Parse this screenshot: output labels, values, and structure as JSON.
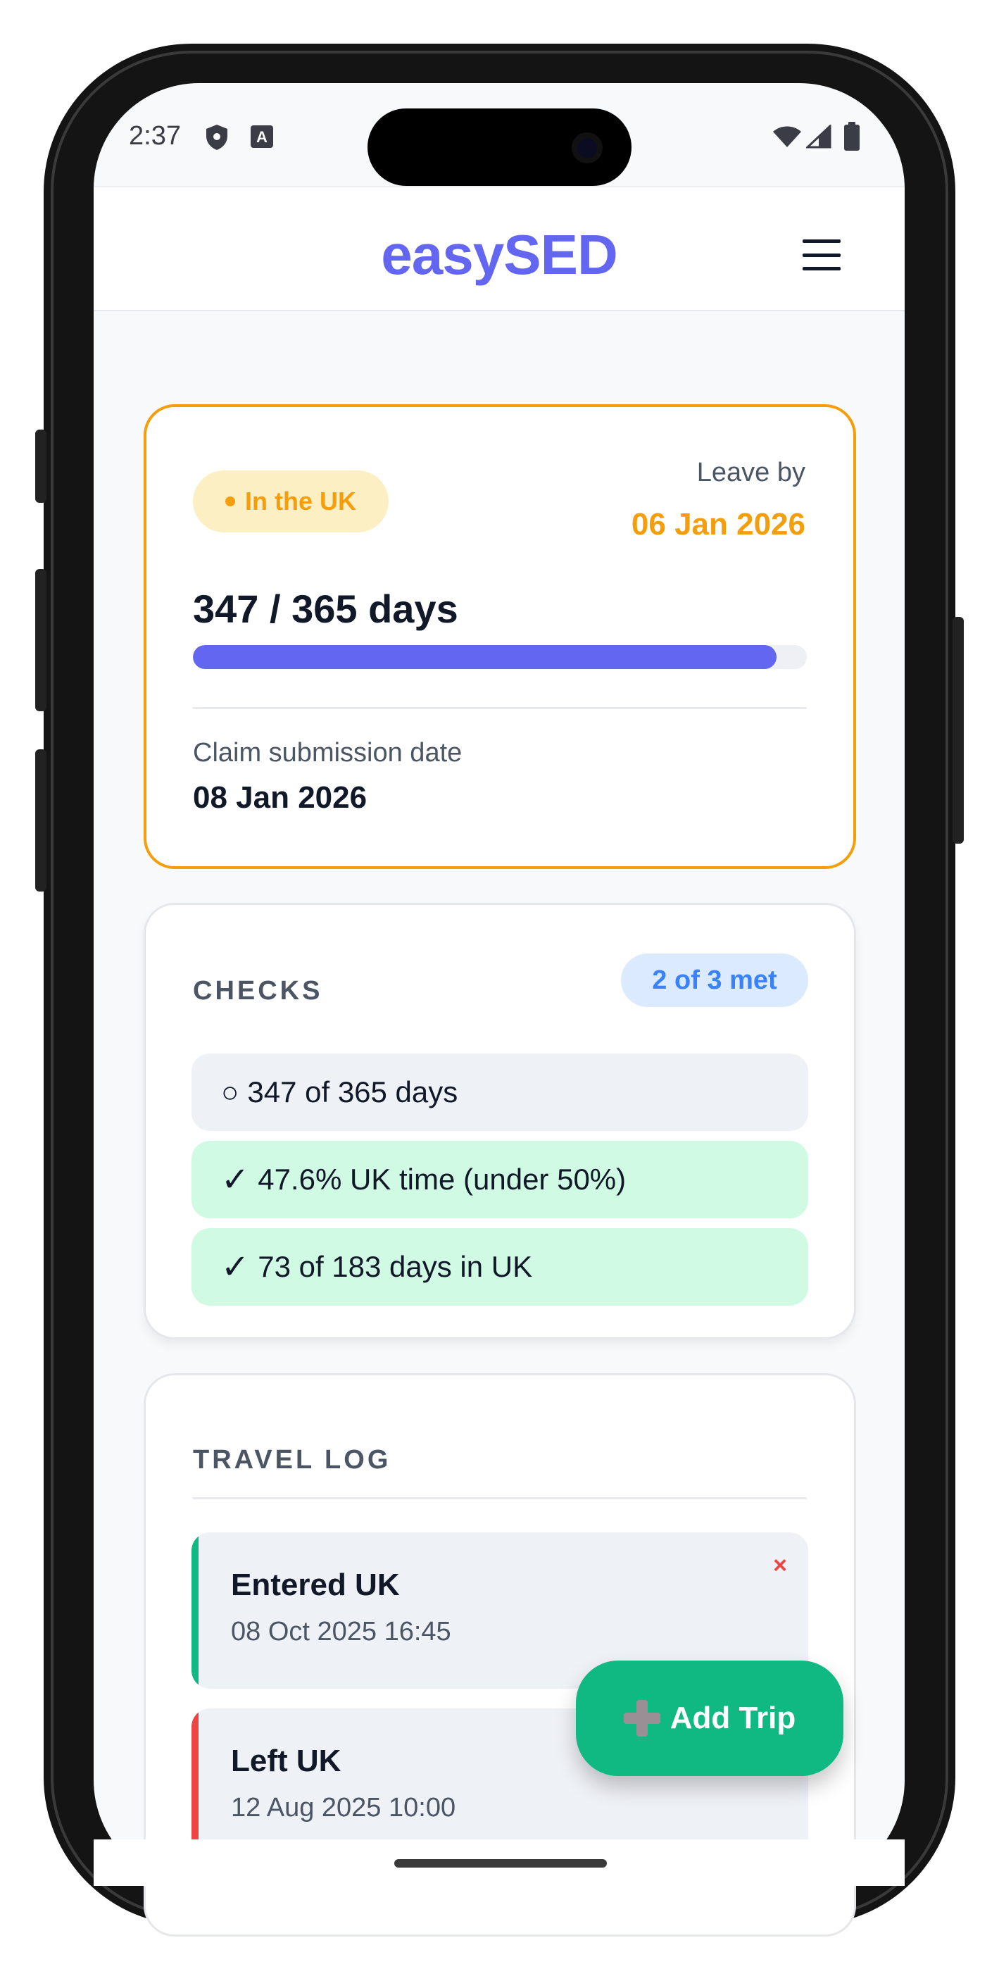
{
  "status_bar": {
    "time": "2:37",
    "left_icons": [
      "shield-icon",
      "a-letter-icon"
    ],
    "right_icons": [
      "wifi-icon",
      "signal-icon",
      "battery-icon"
    ]
  },
  "header": {
    "logo": "easySED",
    "menu_icon": "hamburger-menu-icon"
  },
  "status_card": {
    "badge": "In the UK",
    "leave_label": "Leave by",
    "leave_date": "06 Jan 2026",
    "days_text": "347 / 365 days",
    "progress": 0.9507,
    "claim_label": "Claim submission date",
    "claim_date": "08 Jan 2026"
  },
  "checks": {
    "title": "CHECKS",
    "met_badge": "2 of 3 met",
    "items": [
      {
        "symbol": "○",
        "text": "347 of 365 days",
        "met": false
      },
      {
        "symbol": "✓",
        "text": "47.6% UK time (under 50%)",
        "met": true
      },
      {
        "symbol": "✓",
        "text": "73 of 183 days in UK",
        "met": true
      }
    ]
  },
  "travel_log": {
    "title": "TRAVEL LOG",
    "entries": [
      {
        "title": "Entered UK",
        "time": "08 Oct 2025 16:45",
        "delete": "×"
      },
      {
        "title": "Left UK",
        "time": "12 Aug 2025 10:00"
      }
    ]
  },
  "fab": {
    "label": "Add Trip",
    "icon": "plus-icon"
  },
  "colors": {
    "brand": "#6366f1",
    "warning": "#f59e0b",
    "success": "#10b981",
    "danger": "#ef4444",
    "info": "#3b82f6"
  }
}
